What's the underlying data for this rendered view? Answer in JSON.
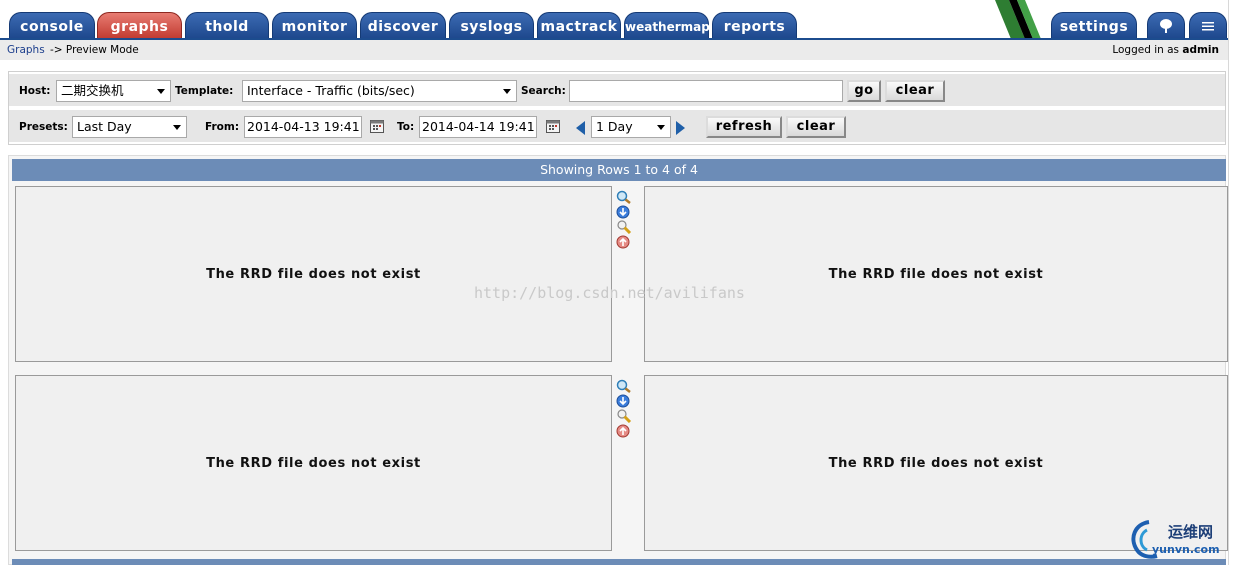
{
  "tabs": [
    {
      "label": "console",
      "active": false
    },
    {
      "label": "graphs",
      "active": true
    },
    {
      "label": "thold",
      "active": false
    },
    {
      "label": "monitor",
      "active": false
    },
    {
      "label": "discover",
      "active": false
    },
    {
      "label": "syslogs",
      "active": false
    },
    {
      "label": "mactrack",
      "active": false
    },
    {
      "label": "weathermap",
      "active": false
    },
    {
      "label": "reports",
      "active": false
    }
  ],
  "right_tabs": {
    "settings": "settings"
  },
  "breadcrumb": {
    "link": "Graphs",
    "rest": "-> Preview Mode"
  },
  "login": {
    "prefix": "Logged in as",
    "user": "admin"
  },
  "filter": {
    "host_label": "Host:",
    "host_value": "二期交换机",
    "template_label": "Template:",
    "template_value": "Interface - Traffic (bits/sec)",
    "search_label": "Search:",
    "search_value": "",
    "go_label": "go",
    "clear_label": "clear",
    "presets_label": "Presets:",
    "presets_value": "Last Day",
    "from_label": "From:",
    "from_value": "2014-04-13 19:41",
    "to_label": "To:",
    "to_value": "2014-04-14 19:41",
    "span_value": "1 Day",
    "refresh_label": "refresh",
    "clear2_label": "clear"
  },
  "rows_status": "Showing Rows 1 to 4 of 4",
  "graphs": [
    {
      "message": "The RRD file does not exist"
    },
    {
      "message": "The RRD file does not exist"
    },
    {
      "message": "The RRD file does not exist"
    },
    {
      "message": "The RRD file does not exist"
    }
  ],
  "watermark": "http://blog.csdn.net/avilifans",
  "logo": {
    "cn": "运维网",
    "en": "yunvn.com"
  },
  "colors": {
    "tab": "#2a5aa0",
    "tab_active": "#d0463b",
    "header_bar": "#6c8cb7",
    "panel": "#e6e6e6"
  }
}
